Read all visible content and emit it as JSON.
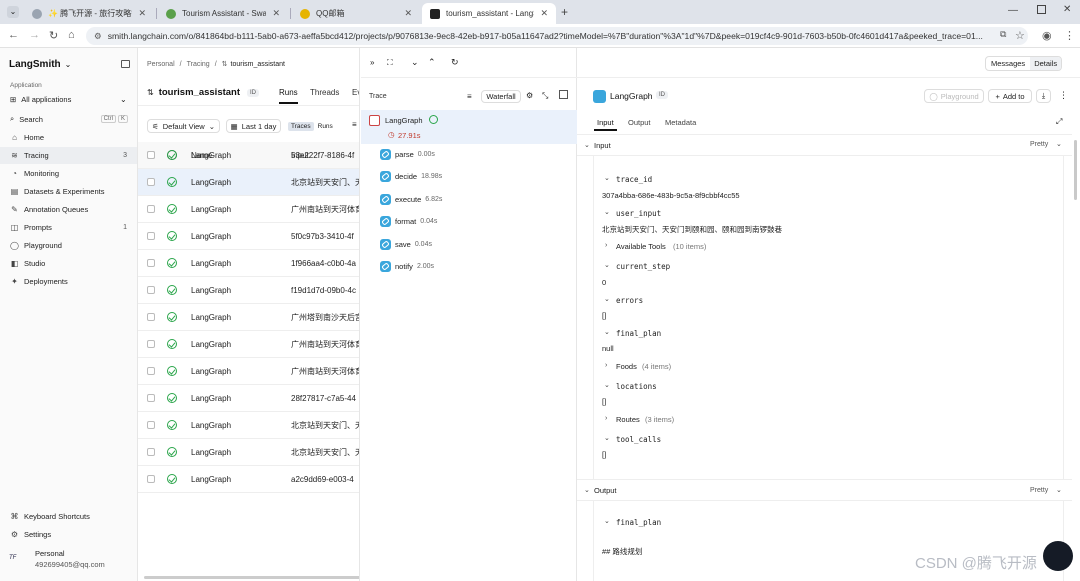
{
  "browser": {
    "tabs": [
      {
        "title": "✨ 腾飞开源 - 旅行攻略智能助手",
        "active": false,
        "fav": "#e8a23a"
      },
      {
        "title": "Tourism Assistant - Swagger UI",
        "active": false,
        "fav": "#5aa04a"
      },
      {
        "title": "QQ邮箱",
        "active": false,
        "fav": "#e6b400"
      },
      {
        "title": "tourism_assistant - LangSmith",
        "active": true,
        "fav": "#222"
      }
    ],
    "url": "smith.langchain.com/o/841864bd-b111-5ab0-a673-aeffa5bcd412/projects/p/9076813e-9ec8-42eb-b917-b05a11647ad2?timeModel=%7B\"duration\"%3A\"1d\"%7D&peek=019cf4c9-901d-7603-b50b-0fc4601d417a&peeked_trace=01..."
  },
  "sidebar": {
    "brand": "LangSmith",
    "section": "Application",
    "all_apps": "All applications",
    "search": "Search",
    "search_kbd1": "Ctrl",
    "search_kbd2": "K",
    "items": [
      {
        "label": "Home",
        "icon": "⌂",
        "count": ""
      },
      {
        "label": "Tracing",
        "icon": "≋",
        "count": "3"
      },
      {
        "label": "Monitoring",
        "icon": "◔",
        "count": ""
      },
      {
        "label": "Datasets & Experiments",
        "icon": "▤",
        "count": ""
      },
      {
        "label": "Annotation Queues",
        "icon": "✎",
        "count": ""
      },
      {
        "label": "Prompts",
        "icon": "◫",
        "count": "1"
      },
      {
        "label": "Playground",
        "icon": "◯",
        "count": ""
      },
      {
        "label": "Studio",
        "icon": "◧",
        "count": ""
      },
      {
        "label": "Deployments",
        "icon": "✦",
        "count": ""
      }
    ],
    "shortcuts": "Keyboard Shortcuts",
    "settings": "Settings",
    "user_name": "Personal",
    "user_email": "492699405@qq.com"
  },
  "runs": {
    "breadcrumb": [
      "Personal",
      "/",
      "Tracing",
      "/"
    ],
    "breadcrumb_current": "tourism_assistant",
    "project": "tourism_assistant",
    "id_badge": "ID",
    "tabs": [
      "Runs",
      "Threads",
      "Ev"
    ],
    "view": "Default View",
    "time": "Last 1 day",
    "seg": [
      "Traces",
      "Runs"
    ],
    "col_name": "Name",
    "col_input": "Input",
    "rows": [
      {
        "name": "LangGraph",
        "input": "53e222f7-8186-4f"
      },
      {
        "name": "LangGraph",
        "input": "北京站到天安门、天"
      },
      {
        "name": "LangGraph",
        "input": "广州南站到天河体育"
      },
      {
        "name": "LangGraph",
        "input": "5f0c97b3-3410-4f"
      },
      {
        "name": "LangGraph",
        "input": "1f966aa4-c0b0-4a"
      },
      {
        "name": "LangGraph",
        "input": "f19d1d7d-09b0-4c"
      },
      {
        "name": "LangGraph",
        "input": "广州塔到南沙天后宫"
      },
      {
        "name": "LangGraph",
        "input": "广州南站到天河体育"
      },
      {
        "name": "LangGraph",
        "input": "广州南站到天河体育"
      },
      {
        "name": "LangGraph",
        "input": "28f27817-c7a5-44"
      },
      {
        "name": "LangGraph",
        "input": "北京站到天安门、天"
      },
      {
        "name": "LangGraph",
        "input": "北京站到天安门、天"
      },
      {
        "name": "LangGraph",
        "input": "a2c9dd69-e003-4"
      }
    ]
  },
  "trace": {
    "title": "Trace",
    "waterfall": "Waterfall",
    "root": "LangGraph",
    "root_dur": "27.91s",
    "nodes": [
      {
        "name": "parse",
        "dur": "0.00s"
      },
      {
        "name": "decide",
        "dur": "18.98s"
      },
      {
        "name": "execute",
        "dur": "6.82s"
      },
      {
        "name": "format",
        "dur": "0.04s"
      },
      {
        "name": "save",
        "dur": "0.04s"
      },
      {
        "name": "notify",
        "dur": "2.00s"
      }
    ]
  },
  "details": {
    "messages_btn": "Messages",
    "details_btn": "Details",
    "title": "LangGraph",
    "id_badge": "ID",
    "playground": "Playground",
    "add_to": "Add to",
    "tabs": [
      "Input",
      "Output",
      "Metadata"
    ],
    "input_section": "Input",
    "output_section": "Output",
    "pretty": "Pretty",
    "fields": {
      "trace_id_k": "trace_id",
      "trace_id_v": "307a4bba-686e-483b-9c5a-8f9cbbf4cc55",
      "user_input_k": "user_input",
      "user_input_v": "北京站到天安门、天安门到颐和园、颐和园到南锣鼓巷",
      "tools_k": "Available Tools",
      "tools_n": "(10 items)",
      "step_k": "current_step",
      "step_v": "0",
      "errors_k": "errors",
      "errors_v": "[]",
      "plan_k": "final_plan",
      "plan_v": "null",
      "foods_k": "Foods",
      "foods_n": "(4 items)",
      "loc_k": "locations",
      "loc_v": "[]",
      "routes_k": "Routes",
      "routes_n": "(3 items)",
      "tool_calls_k": "tool_calls",
      "tool_calls_v": "[]",
      "out_plan_k": "final_plan",
      "out_plan_v": "## 路线规划"
    }
  },
  "watermark": "CSDN @腾飞开源"
}
